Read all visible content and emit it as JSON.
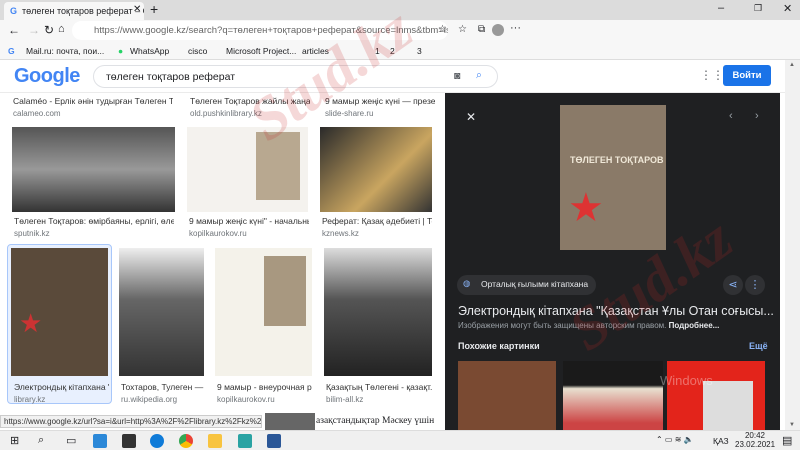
{
  "browser": {
    "tab_title": "төлеген тоқтаров реферат – Go",
    "url": "https://www.google.kz/search?q=төлеген+тоқтаров+реферат&source=lnms&tbm=isch&sa=X&ved=2ahUKEwiTlafHiIDvAh...",
    "bookmarks": [
      "Mail.ru: почта, пои...",
      "WhatsApp",
      "cisco",
      "Microsoft Project...",
      "articles",
      "1",
      "2",
      "3"
    ],
    "status_url": "https://www.google.kz/url?sa=i&url=http%3A%2F%2Flibrary.kz%2Fkz%2Fgylymi-..."
  },
  "google": {
    "logo": "Google",
    "query": "төлеген тоқтаров реферат",
    "signin": "Войти"
  },
  "results_row1": [
    {
      "title": "Calaméo - Ерлік әнін тудырған Төлеген Тоқта...",
      "source": "calameo.com"
    },
    {
      "title": "Төлеген Тоқтаров жайлы жаңа к...",
      "source": "old.pushkinlibrary.kz"
    },
    {
      "title": "9 мамыр жеңіс күні — презен...",
      "source": "slide-share.ru"
    }
  ],
  "results_row2": [
    {
      "title": "Төлеген Тоқтаров: өмірбаяны, ерлігі, өлеңде...",
      "source": "sputnik.kz"
    },
    {
      "title": "9 мамыр жеңіс күні\" - начальны...",
      "source": "kopilkaurokov.ru"
    },
    {
      "title": "Реферат: Қазақ әдебиеті | Тоқ...",
      "source": "kznews.kz"
    }
  ],
  "results_row3": [
    {
      "title": "Электрондық кітапхана \"...",
      "source": "library.kz"
    },
    {
      "title": "Тохтаров, Тулеген — В...",
      "source": "ru.wikipedia.org"
    },
    {
      "title": "9 мамыр - внеурочная ра...",
      "source": "kopilkaurokov.ru"
    },
    {
      "title": "Қазақтың Төлегені - қазақт...",
      "source": "bilim-all.kz"
    }
  ],
  "partial_text": "азақстандықтар Мәскеу үшін",
  "panel": {
    "book_title": "ТӨЛЕГЕН ТОҚТАРОВ",
    "source_chip": "Орталық ғылыми кітапхана",
    "title": "Электрондық кітапхана \"Қазақстан Ұлы Отан соғысы...",
    "copyright": "Изображения могут быть защищены авторским правом.",
    "more_link": "Подробнее...",
    "similar_heading": "Похожие картинки",
    "similar_more": "Ещё"
  },
  "watermark": "Stud.kz",
  "activation": "Windows",
  "taskbar": {
    "lang": "ҚАЗ",
    "time": "20:42",
    "date": "23.02.2021"
  },
  "colors": {
    "accent": "#1a73e8",
    "panel_bg": "#1f2022"
  }
}
